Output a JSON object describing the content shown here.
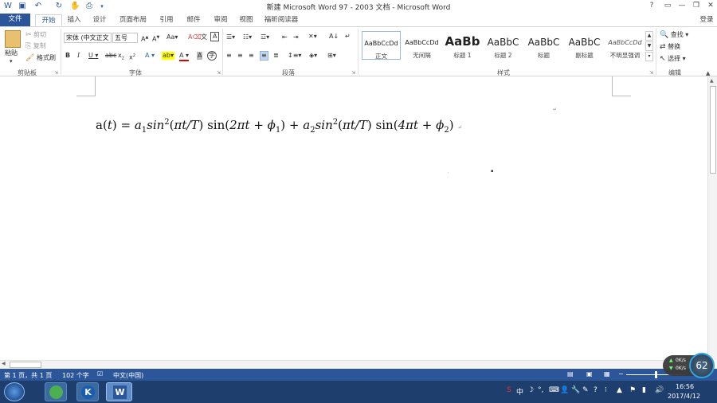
{
  "window": {
    "title": "新建 Microsoft Word 97 - 2003 文档 - Microsoft Word",
    "help": "?",
    "login": "登录"
  },
  "tabs": [
    "文件",
    "开始",
    "插入",
    "设计",
    "页面布局",
    "引用",
    "邮件",
    "审阅",
    "视图",
    "福昕阅读器"
  ],
  "clipboard": {
    "paste": "粘贴",
    "cut": "剪切",
    "copy": "复制",
    "format_painter": "格式刷",
    "group": "剪贴板"
  },
  "font": {
    "name": "宋体 (中文正文",
    "size": "五号",
    "group": "字体"
  },
  "paragraph": {
    "group": "段落"
  },
  "styles": {
    "items": [
      {
        "preview": "AaBbCcDd",
        "name": "正文"
      },
      {
        "preview": "AaBbCcDd",
        "name": "无间隔"
      },
      {
        "preview": "AaBb",
        "name": "标题 1"
      },
      {
        "preview": "AaBbC",
        "name": "标题 2"
      },
      {
        "preview": "AaBbC",
        "name": "标题"
      },
      {
        "preview": "AaBbC",
        "name": "副标题"
      },
      {
        "preview": "AaBbCcDd",
        "name": "不明显强调"
      }
    ],
    "group": "样式"
  },
  "editing": {
    "find": "查找",
    "replace": "替换",
    "select": "选择",
    "group": "编辑"
  },
  "document": {
    "equation": {
      "lhs": "a",
      "var": "t",
      "a1": "a",
      "a1_sub": "1",
      "sin_italic": "sin",
      "sup": "2",
      "pi_t_T": "πt/T",
      "sin": "sin",
      "two_pi_t": "2πt + ",
      "phi": "ϕ",
      "phi1_sub": "1",
      "plus": " + ",
      "a2_sub": "2",
      "four_pi_t": "4πt + ",
      "phi2_sub": "2"
    }
  },
  "status": {
    "page": "第 1 页，共 1 页",
    "words": "102 个字",
    "lang": "中文(中国)"
  },
  "tray": {
    "time": "16:56",
    "date": "2017/4/12",
    "badge": "62",
    "net_up": "0K/s",
    "net_down": "0K/s"
  },
  "colors": {
    "accent": "#2b579a",
    "taskbar": "#1e3e6e"
  }
}
